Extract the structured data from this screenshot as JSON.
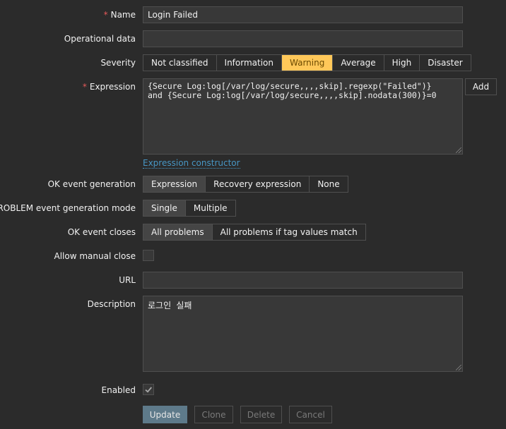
{
  "form": {
    "name": {
      "label": "Name",
      "value": "Login Failed"
    },
    "operational_data": {
      "label": "Operational data",
      "value": ""
    },
    "severity": {
      "label": "Severity",
      "options": [
        "Not classified",
        "Information",
        "Warning",
        "Average",
        "High",
        "Disaster"
      ],
      "selected": "Warning"
    },
    "expression": {
      "label": "Expression",
      "value": "{Secure Log:log[/var/log/secure,,,,skip].regexp(\"Failed\")}\nand {Secure Log:log[/var/log/secure,,,,skip].nodata(300)}=0",
      "add_label": "Add",
      "constructor_link": "Expression constructor"
    },
    "ok_event_generation": {
      "label": "OK event generation",
      "options": [
        "Expression",
        "Recovery expression",
        "None"
      ],
      "selected": "Expression"
    },
    "problem_mode": {
      "label": "PROBLEM event generation mode",
      "options": [
        "Single",
        "Multiple"
      ],
      "selected": "Single"
    },
    "ok_event_closes": {
      "label": "OK event closes",
      "options": [
        "All problems",
        "All problems if tag values match"
      ],
      "selected": "All problems"
    },
    "allow_manual_close": {
      "label": "Allow manual close",
      "checked": false
    },
    "url": {
      "label": "URL",
      "value": ""
    },
    "description": {
      "label": "Description",
      "value": "로그인 실패"
    },
    "enabled": {
      "label": "Enabled",
      "checked": true
    }
  },
  "actions": {
    "update": "Update",
    "clone": "Clone",
    "delete": "Delete",
    "cancel": "Cancel"
  },
  "colors": {
    "background": "#2b2b2b",
    "warning": "#ffc859",
    "link": "#4796c4",
    "required": "#e45959",
    "primary_button": "#5e7a8a"
  },
  "icons": {
    "enabled_check": "checkmark-icon"
  }
}
